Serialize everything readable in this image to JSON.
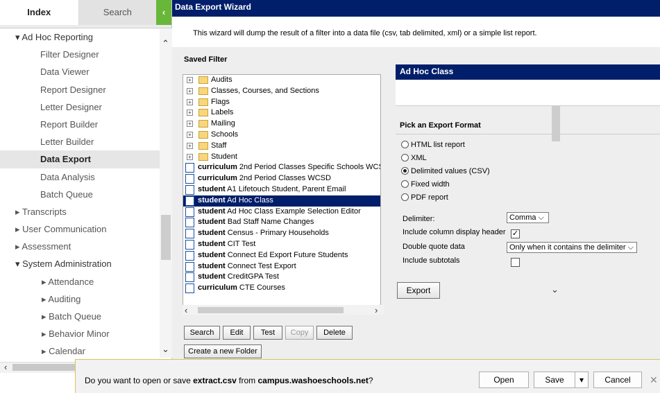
{
  "sidebar": {
    "tab_index": "Index",
    "tab_search": "Search",
    "collapse_glyph": "‹",
    "items": [
      {
        "label": "▾ Ad Hoc Reporting",
        "lvl": "l0 tri head"
      },
      {
        "label": "Filter Designer",
        "lvl": "l1"
      },
      {
        "label": "Data Viewer",
        "lvl": "l1"
      },
      {
        "label": "Report Designer",
        "lvl": "l1"
      },
      {
        "label": "Letter Designer",
        "lvl": "l1"
      },
      {
        "label": "Report Builder",
        "lvl": "l1"
      },
      {
        "label": "Letter Builder",
        "lvl": "l1"
      },
      {
        "label": "Data Export",
        "lvl": "l1 sel"
      },
      {
        "label": "Data Analysis",
        "lvl": "l1"
      },
      {
        "label": "Batch Queue",
        "lvl": "l1"
      },
      {
        "label": "▸ Transcripts",
        "lvl": "l0 tri"
      },
      {
        "label": "▸ User Communication",
        "lvl": "l0 tri"
      },
      {
        "label": "▸ Assessment",
        "lvl": "l0 tri"
      },
      {
        "label": "▾ System Administration",
        "lvl": "l0 tri head"
      },
      {
        "label": "▸ Attendance",
        "lvl": "l2"
      },
      {
        "label": "▸ Auditing",
        "lvl": "l2"
      },
      {
        "label": "▸ Batch Queue",
        "lvl": "l2"
      },
      {
        "label": "▸ Behavior Minor",
        "lvl": "l2"
      },
      {
        "label": "▸ Calendar",
        "lvl": "l2"
      }
    ]
  },
  "wizard": {
    "title": "Data Export Wizard",
    "intro": "This wizard will dump the result of a filter into a data file (csv, tab delimited, xml) or a simple list report.",
    "saved_filter_label": "Saved Filter",
    "folders": [
      "Audits",
      "Classes, Courses, and Sections",
      "Flags",
      "Labels",
      "Mailing",
      "Schools",
      "Staff",
      "Student"
    ],
    "filters": [
      {
        "type": "curriculum",
        "name": " 2nd Period Classes Specific Schools WCS"
      },
      {
        "type": "curriculum",
        "name": " 2nd Period Classes WCSD"
      },
      {
        "type": "student",
        "name": " A1 Lifetouch Student, Parent Email"
      },
      {
        "type": "student",
        "name": " Ad Hoc Class",
        "selected": true
      },
      {
        "type": "student",
        "name": " Ad Hoc Class Example Selection Editor"
      },
      {
        "type": "student",
        "name": " Bad Staff Name Changes"
      },
      {
        "type": "student",
        "name": " Census - Primary Households"
      },
      {
        "type": "student",
        "name": " CIT Test"
      },
      {
        "type": "student",
        "name": " Connect Ed Export Future Students"
      },
      {
        "type": "student",
        "name": " Connect Test Export"
      },
      {
        "type": "student",
        "name": " CreditGPA Test"
      },
      {
        "type": "curriculum",
        "name": " CTE Courses"
      }
    ],
    "buttons": {
      "search": "Search",
      "edit": "Edit",
      "test": "Test",
      "copy": "Copy",
      "delete": "Delete",
      "new_folder": "Create a new Folder"
    },
    "selected_title": "Ad Hoc Class",
    "format_label": "Pick an Export Format",
    "formats": [
      {
        "label": "HTML list report",
        "checked": false
      },
      {
        "label": "XML",
        "checked": false
      },
      {
        "label": "Delimited values (CSV)",
        "checked": true
      },
      {
        "label": "Fixed width",
        "checked": false
      },
      {
        "label": "PDF report",
        "checked": false
      }
    ],
    "delimiter_label": "Delimiter:",
    "delimiter_value": "Comma",
    "header_label": "Include column display header",
    "header_checked": "✓",
    "quote_label": "Double quote data",
    "quote_value": "Only when it contains the delimiter",
    "subtotals_label": "Include subtotals",
    "export_button": "Export"
  },
  "download": {
    "msg_pre": "Do you want to open or save ",
    "file": "extract.csv",
    "msg_mid": " from ",
    "host": "campus.washoeschools.net",
    "msg_end": "?",
    "open": "Open",
    "save": "Save",
    "cancel": "Cancel",
    "close": "✕"
  }
}
